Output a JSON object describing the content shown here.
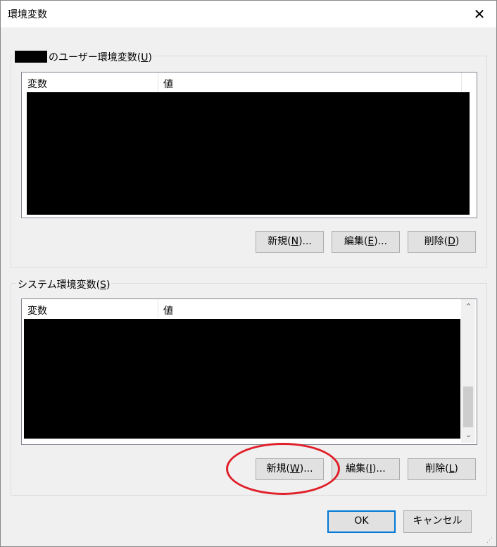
{
  "window": {
    "title": "環境変数",
    "close_glyph": "✕"
  },
  "user_group": {
    "label_suffix": "のユーザー環境変数(",
    "label_key": "U",
    "label_end": ")",
    "col_var": "変数",
    "col_val": "値",
    "buttons": {
      "new": {
        "text": "新規(",
        "key": "N",
        "end": ")..."
      },
      "edit": {
        "text": "編集(",
        "key": "E",
        "end": ")..."
      },
      "delete": {
        "text": "削除(",
        "key": "D",
        "end": ")"
      }
    }
  },
  "system_group": {
    "label": "システム環境変数(",
    "label_key": "S",
    "label_end": ")",
    "col_var": "変数",
    "col_val": "値",
    "buttons": {
      "new": {
        "text": "新規(",
        "key": "W",
        "end": ")..."
      },
      "edit": {
        "text": "編集(",
        "key": "I",
        "end": ")..."
      },
      "delete": {
        "text": "削除(",
        "key": "L",
        "end": ")"
      }
    }
  },
  "footer": {
    "ok": "OK",
    "cancel": "キャンセル"
  },
  "icons": {
    "scroll_up": "⌃",
    "scroll_down": "⌄",
    "grip": "⋰"
  },
  "colors": {
    "annotation": "#e0202a",
    "default_button_border": "#0078d7"
  }
}
